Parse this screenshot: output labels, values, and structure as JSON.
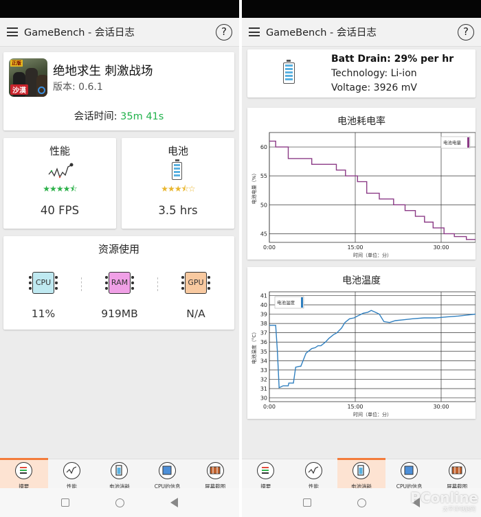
{
  "app": {
    "title": "GameBench - 会话日志",
    "help": "?"
  },
  "left": {
    "game": {
      "name": "绝地求生 刺激战场",
      "version": "版本: 0.6.1",
      "icon_badge": "沙漠",
      "icon_tag": "正版",
      "session_label": "会话时间: ",
      "session_value": "35m 41s"
    },
    "performance": {
      "title": "性能",
      "stars_filled": 4.5,
      "stars_total": 5,
      "value": "40 FPS"
    },
    "battery": {
      "title": "电池",
      "stars_filled": 3.5,
      "stars_total": 5,
      "value": "3.5 hrs"
    },
    "resources": {
      "title": "资源使用",
      "items": [
        {
          "chip": "CPU",
          "value": "11%",
          "color": "#bfe9f1"
        },
        {
          "chip": "RAM",
          "value": "919MB",
          "color": "#f0a0e6"
        },
        {
          "chip": "GPU",
          "value": "N/A",
          "color": "#f8c9a0"
        }
      ]
    }
  },
  "right": {
    "battery_info": {
      "drain": "Batt Drain: 29% per hr",
      "technology": "Technology: Li-ion",
      "voltage": "Voltage: 3926 mV"
    }
  },
  "tabs": [
    {
      "label": "摘要",
      "icon": "summary-icon"
    },
    {
      "label": "性能",
      "icon": "performance-icon"
    },
    {
      "label": "电池消耗",
      "icon": "battery-icon"
    },
    {
      "label": "CPU的信息",
      "icon": "cpu-icon"
    },
    {
      "label": "屏幕截图",
      "icon": "screenshot-icon"
    }
  ],
  "left_active_tab": 0,
  "right_active_tab": 2,
  "colors": {
    "green": "#21b24b",
    "accent": "#f37c3b",
    "batt_line": "#8b3a86",
    "temp_line": "#2f7fbf",
    "star": "#2db14a",
    "star_batt": "#e9b62e"
  },
  "watermark": {
    "main": "PConline",
    "sub": "太平洋电脑网"
  },
  "chart_data": [
    {
      "type": "line",
      "title": "电池耗电率",
      "xlabel": "时间（单位：分）",
      "ylabel": "电池电量（%）",
      "xticks": [
        "0:00",
        "15:00",
        "30:00"
      ],
      "yticks": [
        45,
        50,
        55,
        60
      ],
      "xlim": [
        0,
        36
      ],
      "ylim": [
        43.5,
        62.5
      ],
      "grid": true,
      "legend": "top-right",
      "series": [
        {
          "name": "电池电量",
          "x": [
            0,
            1.1,
            1.1,
            3.3,
            3.3,
            7.4,
            7.4,
            11.7,
            11.7,
            13.3,
            13.3,
            15.4,
            15.4,
            17.0,
            17.0,
            19.2,
            19.2,
            21.7,
            21.7,
            23.7,
            23.7,
            25.5,
            25.5,
            27.1,
            27.1,
            28.6,
            28.6,
            30.5,
            30.5,
            32.3,
            32.3,
            34.4,
            34.4,
            35.4,
            35.4,
            36
          ],
          "y": [
            61,
            61,
            60,
            60,
            58,
            58,
            57,
            57,
            56,
            56,
            55,
            55,
            54,
            54,
            52,
            52,
            51,
            51,
            50,
            50,
            49,
            49,
            48,
            48,
            47,
            47,
            46,
            46,
            45,
            45,
            44.5,
            44.5,
            44,
            44,
            44,
            44
          ]
        }
      ]
    },
    {
      "type": "line",
      "title": "电池温度",
      "xlabel": "时间（单位：分）",
      "ylabel": "电池温度（°C）",
      "xticks": [
        "0:00",
        "15:00",
        "30:00"
      ],
      "yticks": [
        30,
        31,
        32,
        33,
        34,
        35,
        36,
        37,
        38,
        39,
        40,
        41
      ],
      "xlim": [
        0,
        36
      ],
      "ylim": [
        29.6,
        41.4
      ],
      "grid": true,
      "legend": "top-left",
      "series": [
        {
          "name": "电池温度",
          "x": [
            0,
            1.1,
            1.4,
            1.7,
            2.4,
            3.3,
            3.4,
            4.2,
            4.6,
            5.3,
            5.5,
            6.4,
            6.6,
            7.4,
            8.0,
            8.5,
            9.0,
            9.8,
            10.4,
            11.2,
            11.8,
            12.6,
            13.2,
            14.0,
            14.8,
            15.4,
            16.4,
            17.2,
            17.8,
            18.5,
            19.2,
            20.0,
            21.0,
            22.0,
            23.5,
            25.0,
            27.0,
            29.0,
            31.0,
            33.0,
            34.5,
            36.0
          ],
          "y": [
            37.8,
            37.8,
            35,
            31.1,
            31.3,
            31.3,
            31.6,
            31.6,
            33.3,
            33.4,
            33.4,
            34.8,
            34.9,
            35.3,
            35.4,
            35.6,
            35.6,
            36.0,
            36.4,
            36.8,
            37.0,
            37.5,
            38.1,
            38.5,
            38.6,
            38.8,
            39.1,
            39.2,
            39.4,
            39.2,
            39.0,
            38.2,
            38.1,
            38.3,
            38.4,
            38.5,
            38.6,
            38.6,
            38.7,
            38.8,
            38.9,
            39.0
          ]
        }
      ]
    }
  ]
}
